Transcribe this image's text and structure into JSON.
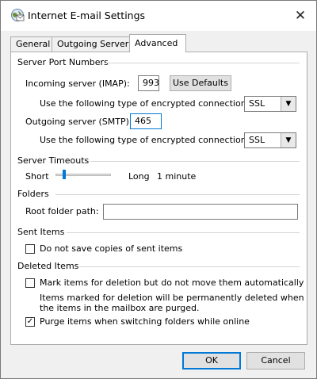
{
  "window": {
    "title": "Internet E-mail Settings",
    "close_glyph": "✕",
    "app_icon": "outlook-globe-icon"
  },
  "tabs": [
    {
      "label": "General"
    },
    {
      "label": "Outgoing Server"
    },
    {
      "label": "Advanced",
      "active": true
    }
  ],
  "server_ports": {
    "heading": "Server Port Numbers",
    "incoming_label": "Incoming server (IMAP):",
    "incoming_value": "993",
    "use_defaults_label": "Use Defaults",
    "incoming_encryption_label": "Use the following type of encrypted connection:",
    "incoming_encryption_value": "SSL",
    "outgoing_label": "Outgoing server (SMTP):",
    "outgoing_value": "465",
    "outgoing_encryption_label": "Use the following type of encrypted connection:",
    "outgoing_encryption_value": "SSL"
  },
  "timeouts": {
    "heading": "Server Timeouts",
    "short_label": "Short",
    "long_label": "Long",
    "value_text": "1 minute"
  },
  "folders": {
    "heading": "Folders",
    "root_label": "Root folder path:",
    "root_value": ""
  },
  "sent_items": {
    "heading": "Sent Items",
    "no_save_label": "Do not save copies of sent items",
    "no_save_checked": false
  },
  "deleted_items": {
    "heading": "Deleted Items",
    "mark_label": "Mark items for deletion but do not move them automatically",
    "mark_checked": false,
    "mark_note_line1": "Items marked for deletion will be permanently deleted when",
    "mark_note_line2": "the items in the mailbox are purged.",
    "purge_label": "Purge items when switching folders while online",
    "purge_checked": true,
    "check_glyph": "✓"
  },
  "footer": {
    "ok_label": "OK",
    "cancel_label": "Cancel"
  },
  "colors": {
    "accent": "#0078d7",
    "panel": "#ffffff",
    "chrome": "#f0f0f0"
  }
}
